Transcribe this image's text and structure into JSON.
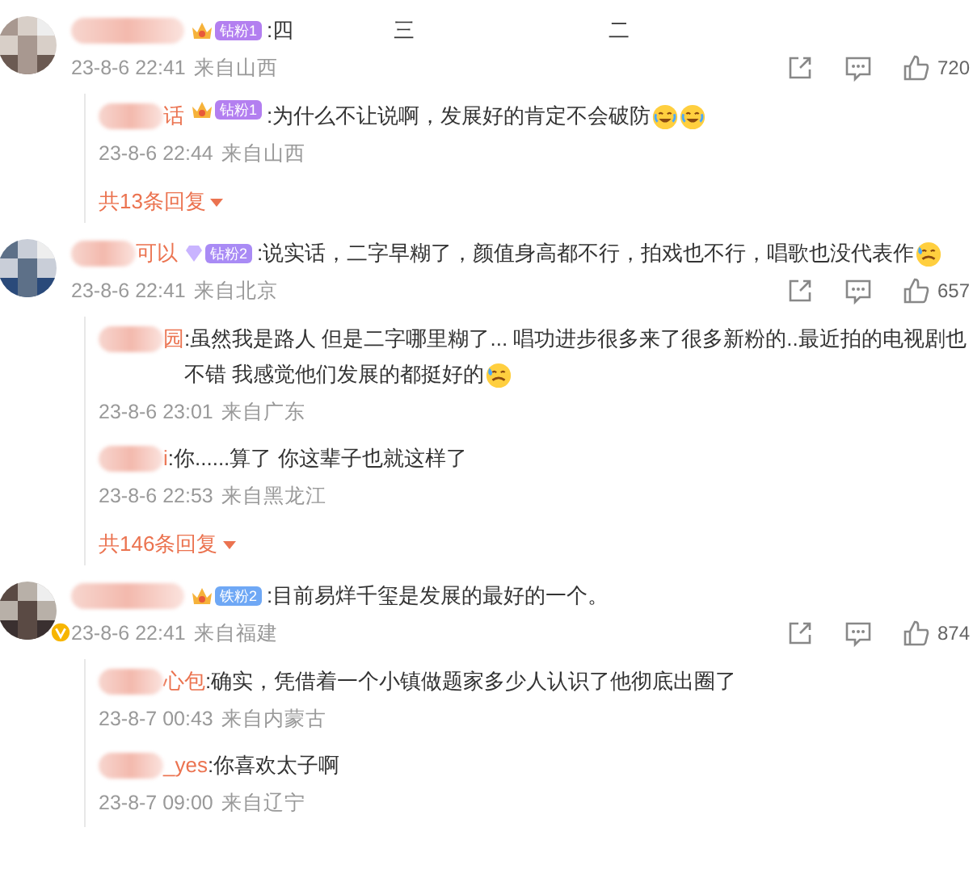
{
  "comments": [
    {
      "badge": {
        "text": "钻粉1",
        "color": "#b37ff0",
        "kind": "crown"
      },
      "verified": false,
      "text_parts": [
        ":四",
        "三",
        "二"
      ],
      "time": "23-8-6 22:41",
      "source": "来自山西",
      "likes": "720",
      "replies": [
        {
          "name_visible": "话",
          "badge": {
            "text": "钻粉1",
            "color": "#b37ff0",
            "kind": "crown"
          },
          "text": ":为什么不让说啊，发展好的肯定不会破防",
          "emojis": [
            {
              "kind": "laugh"
            },
            {
              "kind": "laugh"
            }
          ],
          "time": "23-8-6 22:44",
          "source": "来自山西"
        }
      ],
      "more_replies": "共13条回复"
    },
    {
      "name_visible": "可以",
      "badge": {
        "text": "钻粉2",
        "color": "#a98bf5",
        "kind": "diamond"
      },
      "verified": false,
      "text_parts": [
        ":说实话，二字早糊了，颜值身高都不行，拍戏也不行，唱歌也没代表作"
      ],
      "emojis": [
        {
          "kind": "sweat"
        }
      ],
      "time": "23-8-6 22:41",
      "source": "来自北京",
      "likes": "657",
      "replies": [
        {
          "name_visible": "园",
          "text": ":虽然我是路人 但是二字哪里糊了... 唱功进步很多来了很多新粉的..最近拍的电视剧也不错 我感觉他们发展的都挺好的",
          "emojis": [
            {
              "kind": "sweat"
            }
          ],
          "time": "23-8-6 23:01",
          "source": "来自广东"
        },
        {
          "name_visible": "i",
          "text": ":你......算了 你这辈子也就这样了",
          "time": "23-8-6 22:53",
          "source": "来自黑龙江"
        }
      ],
      "more_replies": "共146条回复"
    },
    {
      "badge": {
        "text": "铁粉2",
        "color": "#6fa8f5",
        "kind": "crown"
      },
      "verified": true,
      "text_parts": [
        ":目前易烊千玺是发展的最好的一个。"
      ],
      "time": "23-8-6 22:41",
      "source": "来自福建",
      "likes": "874",
      "replies": [
        {
          "name_visible": "心包",
          "text": ":确实，凭借着一个小镇做题家多少人认识了他彻底出圈了",
          "time": "23-8-7 00:43",
          "source": "来自内蒙古"
        },
        {
          "name_visible": "_yes",
          "text": ":你喜欢太子啊",
          "time": "23-8-7 09:00",
          "source": "来自辽宁"
        }
      ]
    }
  ]
}
